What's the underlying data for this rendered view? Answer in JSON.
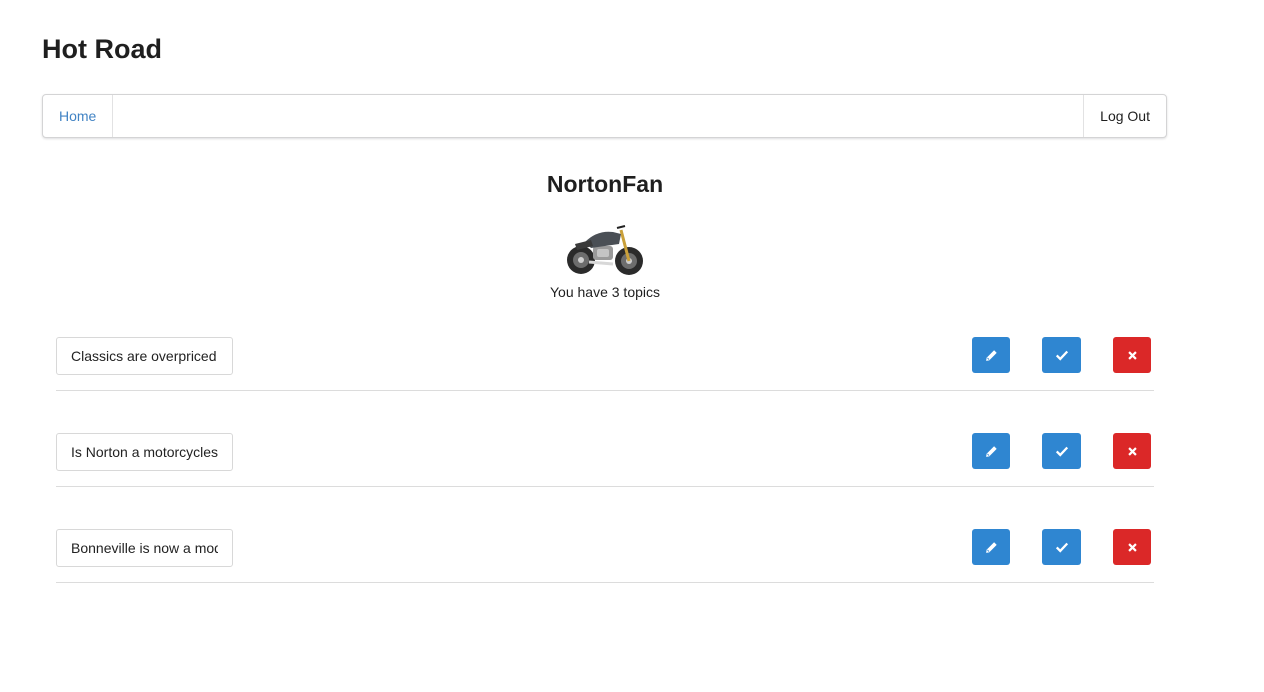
{
  "app": {
    "title": "Hot Road"
  },
  "nav": {
    "home_label": "Home",
    "logout_label": "Log Out"
  },
  "profile": {
    "username": "NortonFan",
    "avatar_icon": "motorcycle-icon",
    "topic_count_text": "You have 3 topics"
  },
  "topics": [
    {
      "title": "Classics are overpriced"
    },
    {
      "title": "Is Norton a motorcycles"
    },
    {
      "title": "Bonneville is now a modern"
    }
  ],
  "actions": {
    "edit_icon": "pencil-icon",
    "done_icon": "check-icon",
    "delete_icon": "x-icon"
  },
  "colors": {
    "link": "#4183c4",
    "primary": "#2f86d1",
    "danger": "#db2828"
  }
}
